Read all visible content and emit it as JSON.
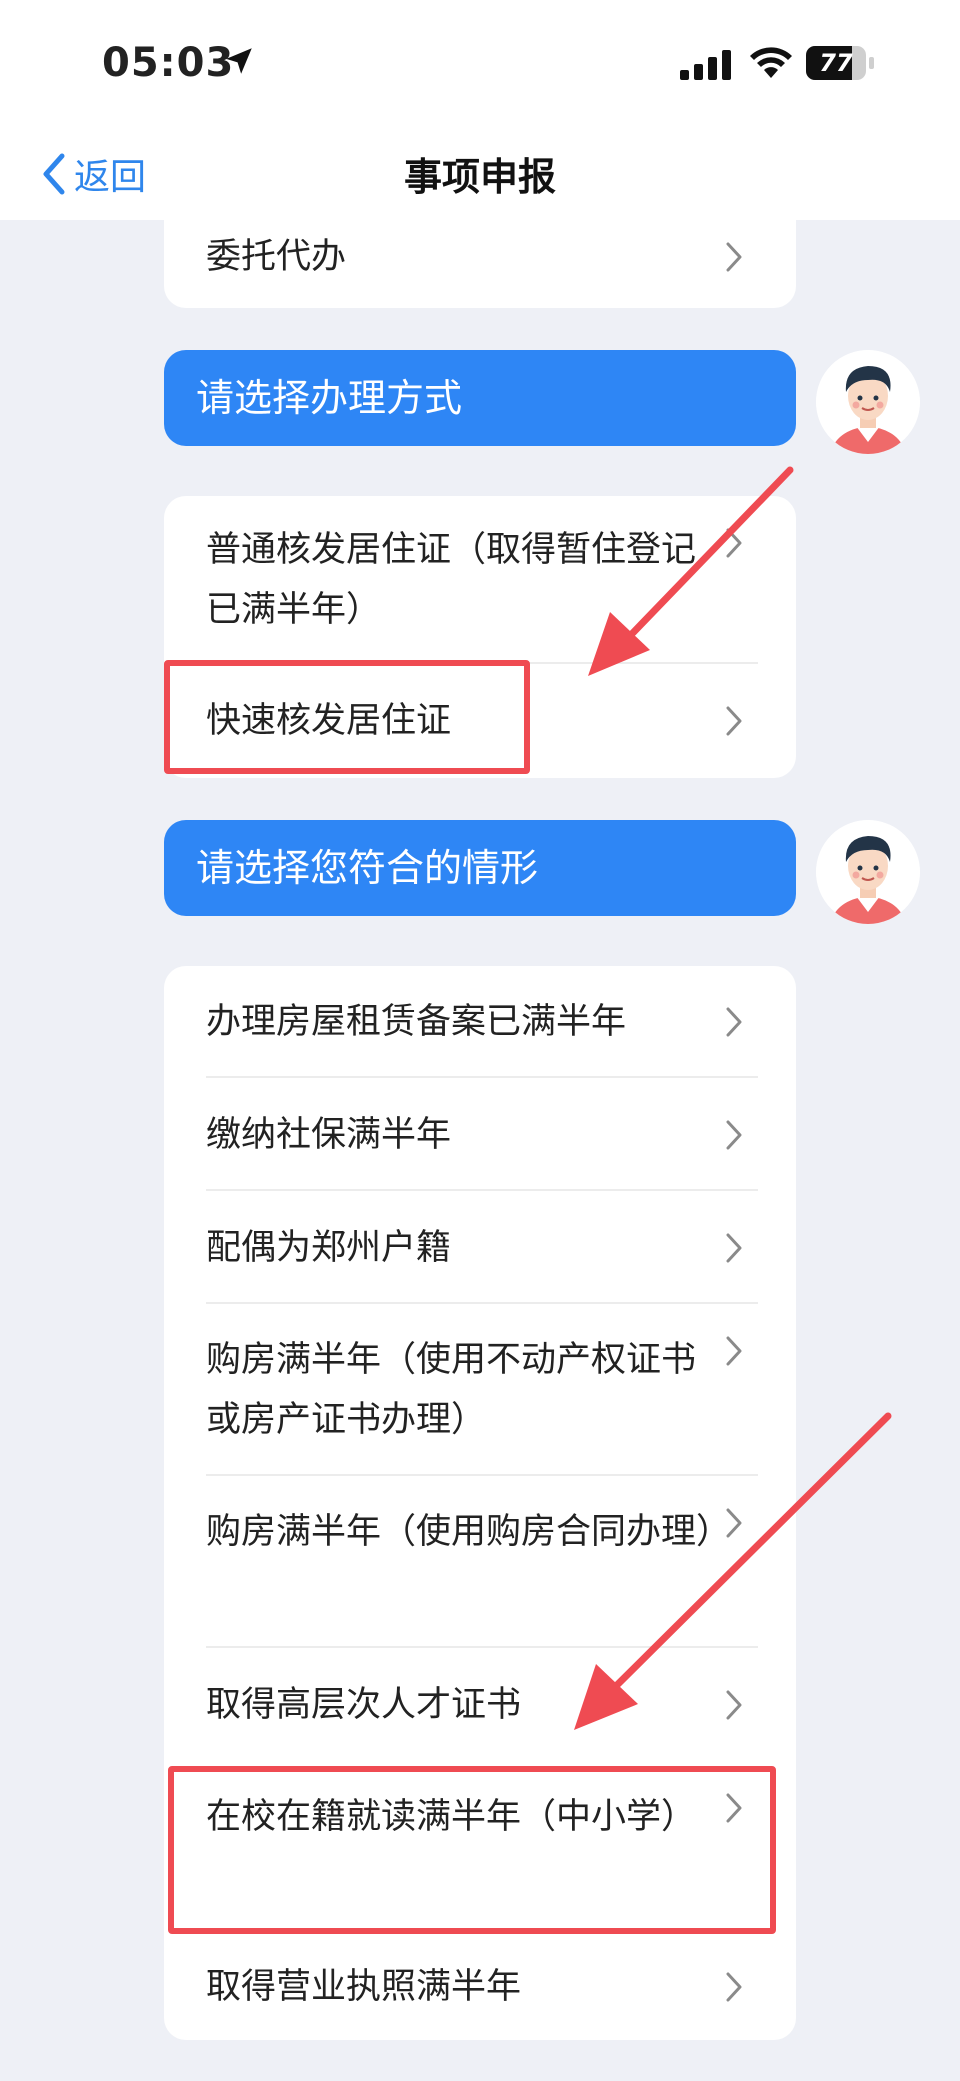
{
  "status_bar": {
    "time": "05:03",
    "battery_level": "77",
    "battery_fraction": 0.77
  },
  "nav": {
    "back_label": "返回",
    "title": "事项申报"
  },
  "top_card": {
    "item": "委托代办"
  },
  "prompt_1": "请选择办理方式",
  "method_options": [
    "普通核发居住证（取得暂住登记已满半年）",
    "快速核发居住证"
  ],
  "prompt_2": "请选择您符合的情形",
  "situation_options": [
    "办理房屋租赁备案已满半年",
    "缴纳社保满半年",
    "配偶为郑州户籍",
    "购房满半年（使用不动产权证书或房产证书办理）",
    "购房满半年（使用购房合同办理）",
    "取得高层次人才证书",
    "在校在籍就读满半年（中小学）",
    "取得营业执照满半年"
  ],
  "colors": {
    "accent": "#2e86f5",
    "highlight": "#ef4b52",
    "background": "#eef0f6"
  },
  "icons": [
    "location-arrow-icon",
    "signal-icon",
    "wifi-icon",
    "battery-icon",
    "chevron-left-icon",
    "chevron-right-icon",
    "assistant-avatar"
  ]
}
